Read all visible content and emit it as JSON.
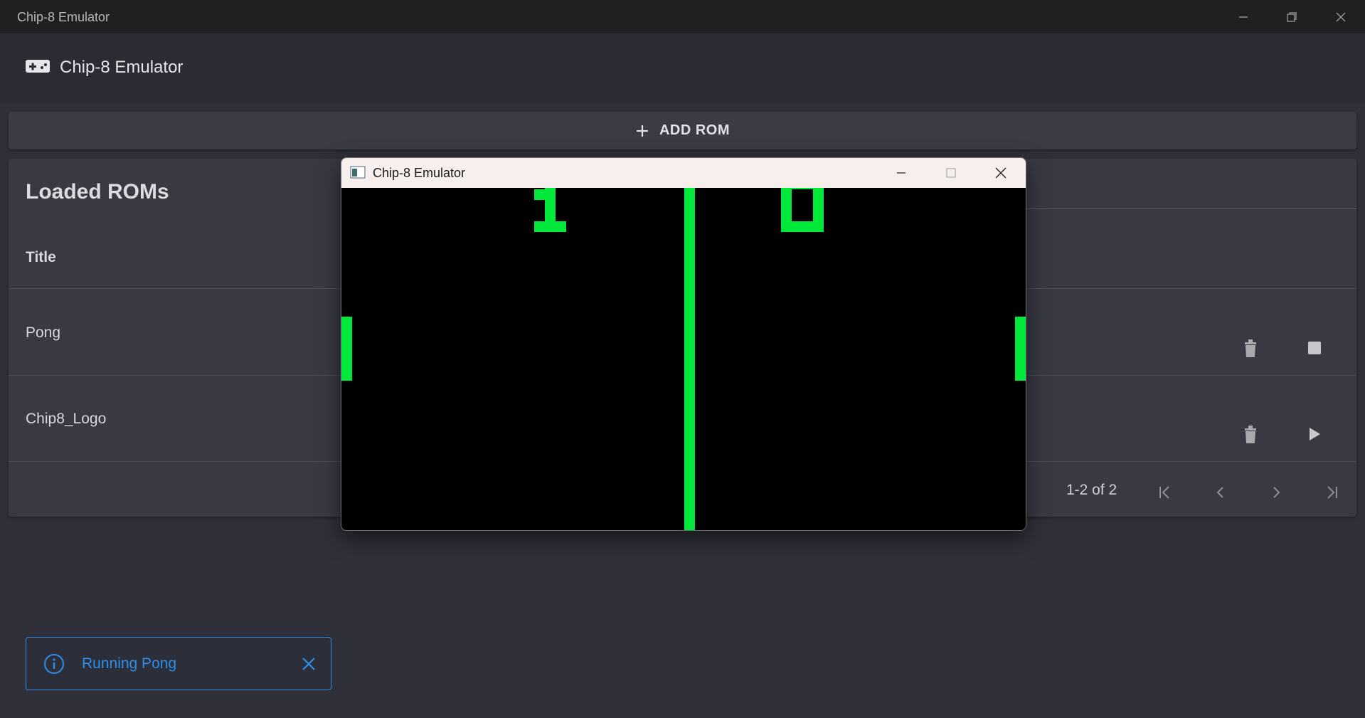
{
  "window": {
    "title": "Chip-8 Emulator"
  },
  "header": {
    "title": "Chip-8 Emulator",
    "logo_icon": "gamepad-icon"
  },
  "toolbar": {
    "add_rom_label": "ADD ROM"
  },
  "roms": {
    "heading": "Loaded ROMs",
    "column_title": "Title",
    "rows": [
      {
        "title": "Pong",
        "action_icon": "stop-icon"
      },
      {
        "title": "Chip8_Logo",
        "action_icon": "play-icon"
      }
    ],
    "pagination": {
      "range_text": "1-2 of 2"
    }
  },
  "snackbar": {
    "message": "Running Pong",
    "color": "#2f8fe8"
  },
  "emulator": {
    "title": "Chip-8 Emulator",
    "score_left": "1",
    "score_right": "0",
    "pixel_color": "#00e83a",
    "background_color": "#000000"
  }
}
